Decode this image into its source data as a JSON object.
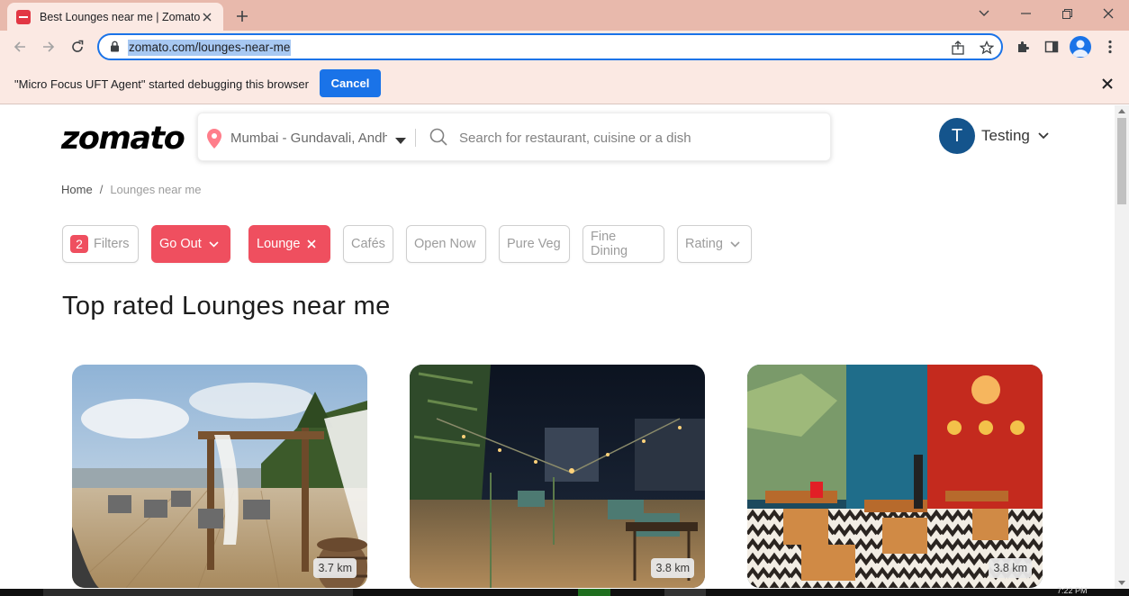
{
  "browser": {
    "tab_title": "Best Lounges near me | Zomato",
    "url": "zomato.com/lounges-near-me"
  },
  "infobar": {
    "message": "\"Micro Focus UFT Agent\" started debugging this browser",
    "cancel_label": "Cancel"
  },
  "header": {
    "logo": "zomato",
    "location": "Mumbai - Gundavali, Andh",
    "search_placeholder": "Search for restaurant, cuisine or a dish",
    "user_initial": "T",
    "user_name": "Testing"
  },
  "breadcrumb": {
    "home": "Home",
    "separator": "/",
    "current": "Lounges near me"
  },
  "filters": {
    "count": "2",
    "filters_label": "Filters",
    "go_out": "Go Out",
    "lounge": "Lounge",
    "cafes": "Cafés",
    "open_now": "Open Now",
    "pure_veg": "Pure Veg",
    "fine_dining": "Fine Dining",
    "rating": "Rating"
  },
  "page": {
    "heading": "Top rated Lounges near me"
  },
  "cards": [
    {
      "distance": "3.7 km"
    },
    {
      "distance": "3.8 km"
    },
    {
      "distance": "3.8 km"
    }
  ],
  "taskbar": {
    "clock": "7:22 PM"
  },
  "colors": {
    "brand": "#ef4f5f",
    "chrome_frame": "#e8b9ac",
    "chrome_toolbar": "#fbe9e3",
    "focus_blue": "#1a73e8"
  }
}
